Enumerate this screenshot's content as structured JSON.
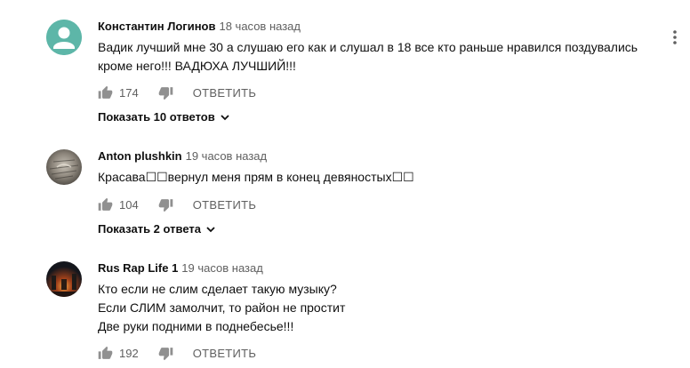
{
  "comments": [
    {
      "author": "Константин Логинов",
      "time": "18 часов назад",
      "lines": [
        "Вадик лучший мне 30 а слушаю его как и слушал в 18 все кто раньше нравился поздувались",
        "кроме него!!! ВАДЮХА ЛУЧШИЙ!!!"
      ],
      "likes": "174",
      "reply_label": "ОТВЕТИТЬ",
      "replies_label": "Показать 10 ответов",
      "avatar": "default-user-icon"
    },
    {
      "author": "Anton plushkin",
      "time": "19 часов назад",
      "lines": [
        "Красава☐☐вернул меня прям в конец девяностых☐☐"
      ],
      "likes": "104",
      "reply_label": "ОТВЕТИТЬ",
      "replies_label": "Показать 2 ответа",
      "avatar": "fur-photo"
    },
    {
      "author": "Rus Rap Life 1",
      "time": "19 часов назад",
      "lines": [
        "Кто если не слим сделает такую музыку?",
        "Если СЛИМ замолчит, то район не простит",
        "Две руки подними в поднебесье!!!"
      ],
      "likes": "192",
      "reply_label": "ОТВЕТИТЬ",
      "avatar": "night-fire-photo"
    }
  ],
  "colors": {
    "secondary_text": "#606060",
    "primary_text": "#0f0f0f",
    "default_avatar": "#5db6a8"
  }
}
